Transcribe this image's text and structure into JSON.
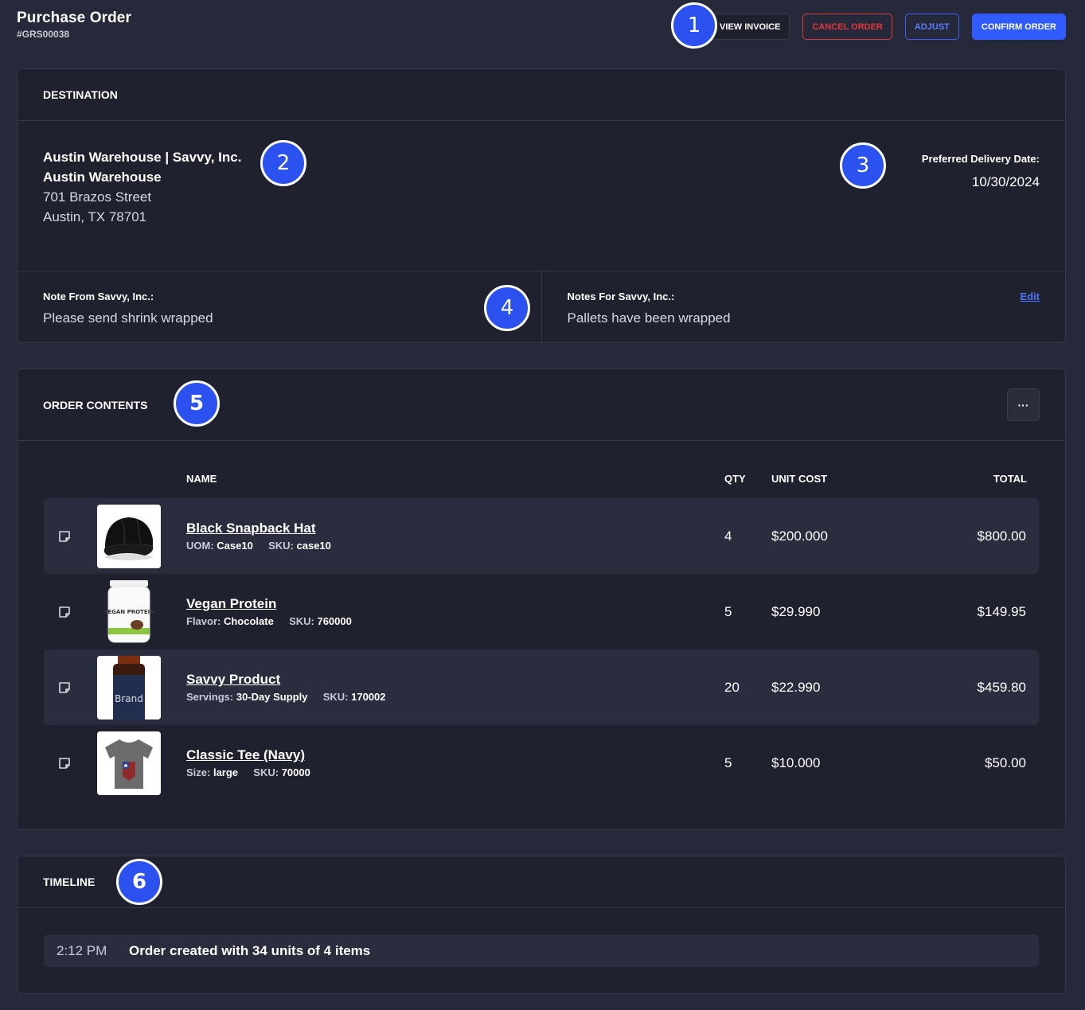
{
  "header": {
    "title": "Purchase Order",
    "order_id": "#GRS00038"
  },
  "actions": {
    "view_invoice": "VIEW INVOICE",
    "cancel_order": "CANCEL ORDER",
    "adjust": "ADJUST",
    "confirm_order": "CONFIRM ORDER"
  },
  "badges": [
    "1",
    "2",
    "3",
    "4",
    "5",
    "6"
  ],
  "destination": {
    "heading": "DESTINATION",
    "name_line": "Austin Warehouse | Savvy, Inc.",
    "warehouse": "Austin Warehouse",
    "street": "701 Brazos Street",
    "city_line": "Austin, TX 78701",
    "delivery_label": "Preferred Delivery Date:",
    "delivery_date": "10/30/2024"
  },
  "notes": {
    "from_label": "Note From Savvy, Inc.:",
    "from_text": "Please send shrink wrapped",
    "for_label": "Notes For Savvy, Inc.:",
    "for_text": "Pallets have been wrapped",
    "edit_label": "Edit"
  },
  "order_contents": {
    "heading": "ORDER CONTENTS",
    "more_label": "···",
    "columns": {
      "name": "NAME",
      "qty": "QTY",
      "unit_cost": "UNIT COST",
      "total": "TOTAL"
    },
    "items": [
      {
        "name": "Black Snapback Hat",
        "attr_label": "UOM:",
        "attr_value": "Case10",
        "sku_label": "SKU:",
        "sku": "case10",
        "qty": "4",
        "unit_cost": "$200.000",
        "total": "$800.00",
        "image_icon": "cap-icon"
      },
      {
        "name": "Vegan Protein",
        "attr_label": "Flavor:",
        "attr_value": "Chocolate",
        "sku_label": "SKU:",
        "sku": "760000",
        "qty": "5",
        "unit_cost": "$29.990",
        "total": "$149.95",
        "image_icon": "protein-tub-icon",
        "image_text": "VEGAN PROTEIN"
      },
      {
        "name": "Savvy Product",
        "attr_label": "Servings:",
        "attr_value": "30-Day Supply",
        "sku_label": "SKU:",
        "sku": "170002",
        "qty": "20",
        "unit_cost": "$22.990",
        "total": "$459.80",
        "image_icon": "supplement-bottle-icon",
        "image_text": "Brand"
      },
      {
        "name": "Classic Tee (Navy)",
        "attr_label": "Size:",
        "attr_value": "large",
        "sku_label": "SKU:",
        "sku": "70000",
        "qty": "5",
        "unit_cost": "$10.000",
        "total": "$50.00",
        "image_icon": "tshirt-icon"
      }
    ]
  },
  "timeline": {
    "heading": "TIMELINE",
    "events": [
      {
        "time": "2:12 PM",
        "text": "Order created with 34 units of 4 items"
      }
    ]
  },
  "colors": {
    "background": "#262939",
    "card": "#1f212e",
    "accent": "#2f5bff",
    "danger": "#e0363f",
    "badge": "#2b52ee"
  }
}
